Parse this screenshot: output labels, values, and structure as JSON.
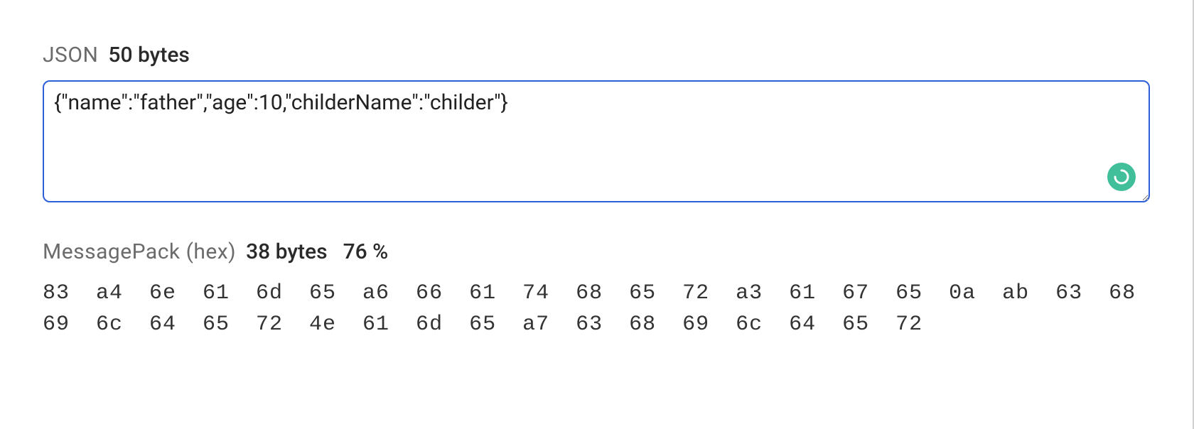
{
  "colors": {
    "focus_border": "#2f5fd8",
    "status_ok": "#41bf9b",
    "label_muted": "#6b6b6b"
  },
  "json_section": {
    "title": "JSON",
    "size_label": "50 bytes",
    "input_value": "{\"name\":\"father\",\"age\":10,\"childerName\":\"childer\"}",
    "status_icon": "spinner-check-icon"
  },
  "msgpack_section": {
    "title": "MessagePack (hex)",
    "size_label": "38 bytes",
    "ratio_label": "76 %",
    "hex_output": "83 a4 6e 61 6d 65 a6 66 61 74 68 65 72 a3 61 67 65 0a ab 63 68 69 6c 64 65 72 4e 61 6d 65 a7 63 68 69 6c 64 65 72"
  }
}
